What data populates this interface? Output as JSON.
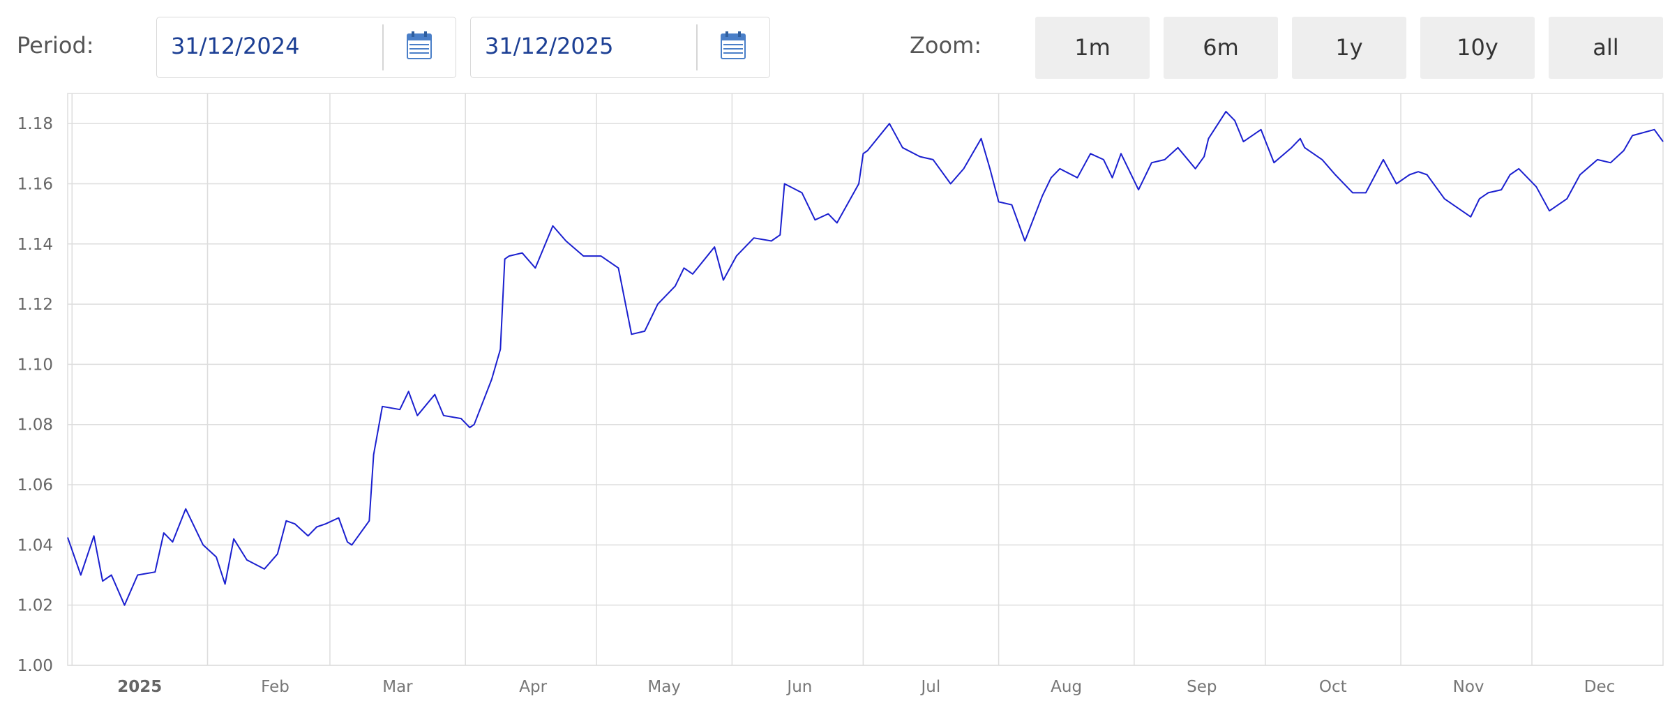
{
  "controls": {
    "period_label": "Period:",
    "date_from": "31/12/2024",
    "date_to": "31/12/2025",
    "zoom_label": "Zoom:",
    "zoom_options": [
      "1m",
      "6m",
      "1y",
      "10y",
      "all"
    ],
    "calendar_icon": "calendar-icon"
  },
  "colors": {
    "line": "#1a1fcf",
    "grid": "#dddddd",
    "date_text": "#1c3f94",
    "calendar": "#4a7fc8",
    "button_bg": "#eeeeee"
  },
  "chart_data": {
    "type": "line",
    "title": "",
    "xlabel": "",
    "ylabel": "",
    "x_range": [
      "2024-12-31",
      "2025-12-31"
    ],
    "ylim": [
      1.0,
      1.19
    ],
    "y_ticks": [
      "1.00",
      "1.02",
      "1.04",
      "1.06",
      "1.08",
      "1.10",
      "1.12",
      "1.14",
      "1.16",
      "1.18"
    ],
    "x_ticks": [
      {
        "date": "2025-01-01",
        "label": "2025",
        "bold": true
      },
      {
        "date": "2025-02-01",
        "label": "Feb"
      },
      {
        "date": "2025-03-01",
        "label": "Mar"
      },
      {
        "date": "2025-04-01",
        "label": "Apr"
      },
      {
        "date": "2025-05-01",
        "label": "May"
      },
      {
        "date": "2025-06-01",
        "label": "Jun"
      },
      {
        "date": "2025-07-01",
        "label": "Jul"
      },
      {
        "date": "2025-08-01",
        "label": "Aug"
      },
      {
        "date": "2025-09-01",
        "label": "Sep"
      },
      {
        "date": "2025-10-01",
        "label": "Oct"
      },
      {
        "date": "2025-11-01",
        "label": "Nov"
      },
      {
        "date": "2025-12-01",
        "label": "Dec"
      }
    ],
    "grid": true,
    "legend": "none",
    "x": [
      "2024-12-31",
      "2025-01-03",
      "2025-01-06",
      "2025-01-08",
      "2025-01-10",
      "2025-01-13",
      "2025-01-16",
      "2025-01-20",
      "2025-01-22",
      "2025-01-24",
      "2025-01-27",
      "2025-01-31",
      "2025-02-03",
      "2025-02-05",
      "2025-02-07",
      "2025-02-10",
      "2025-02-14",
      "2025-02-17",
      "2025-02-19",
      "2025-02-21",
      "2025-02-24",
      "2025-02-26",
      "2025-02-28",
      "2025-03-03",
      "2025-03-05",
      "2025-03-06",
      "2025-03-10",
      "2025-03-11",
      "2025-03-13",
      "2025-03-17",
      "2025-03-19",
      "2025-03-21",
      "2025-03-25",
      "2025-03-27",
      "2025-03-31",
      "2025-04-02",
      "2025-04-03",
      "2025-04-07",
      "2025-04-09",
      "2025-04-10",
      "2025-04-11",
      "2025-04-14",
      "2025-04-17",
      "2025-04-21",
      "2025-04-24",
      "2025-04-28",
      "2025-05-02",
      "2025-05-06",
      "2025-05-09",
      "2025-05-12",
      "2025-05-15",
      "2025-05-19",
      "2025-05-21",
      "2025-05-23",
      "2025-05-28",
      "2025-05-30",
      "2025-06-02",
      "2025-06-06",
      "2025-06-10",
      "2025-06-12",
      "2025-06-13",
      "2025-06-17",
      "2025-06-20",
      "2025-06-23",
      "2025-06-25",
      "2025-06-30",
      "2025-07-01",
      "2025-07-02",
      "2025-07-07",
      "2025-07-10",
      "2025-07-14",
      "2025-07-17",
      "2025-07-21",
      "2025-07-24",
      "2025-07-28",
      "2025-07-30",
      "2025-08-01",
      "2025-08-04",
      "2025-08-07",
      "2025-08-11",
      "2025-08-13",
      "2025-08-15",
      "2025-08-19",
      "2025-08-22",
      "2025-08-25",
      "2025-08-27",
      "2025-08-29",
      "2025-09-02",
      "2025-09-05",
      "2025-09-08",
      "2025-09-11",
      "2025-09-15",
      "2025-09-17",
      "2025-09-18",
      "2025-09-22",
      "2025-09-24",
      "2025-09-26",
      "2025-09-30",
      "2025-10-03",
      "2025-10-07",
      "2025-10-09",
      "2025-10-10",
      "2025-10-14",
      "2025-10-17",
      "2025-10-21",
      "2025-10-24",
      "2025-10-28",
      "2025-10-31",
      "2025-11-03",
      "2025-11-05",
      "2025-11-07",
      "2025-11-11",
      "2025-11-13",
      "2025-11-17",
      "2025-11-19",
      "2025-11-21",
      "2025-11-24",
      "2025-11-26",
      "2025-11-28",
      "2025-12-02",
      "2025-12-05",
      "2025-12-09",
      "2025-12-12",
      "2025-12-16",
      "2025-12-19",
      "2025-12-22",
      "2025-12-24",
      "2025-12-29",
      "2025-12-31"
    ],
    "series": [
      {
        "values": [
          1.0425,
          1.03,
          1.043,
          1.028,
          1.03,
          1.02,
          1.03,
          1.031,
          1.044,
          1.041,
          1.052,
          1.04,
          1.036,
          1.027,
          1.042,
          1.035,
          1.032,
          1.037,
          1.048,
          1.047,
          1.043,
          1.046,
          1.047,
          1.049,
          1.041,
          1.04,
          1.048,
          1.07,
          1.086,
          1.085,
          1.091,
          1.083,
          1.09,
          1.083,
          1.082,
          1.079,
          1.08,
          1.095,
          1.105,
          1.135,
          1.136,
          1.137,
          1.132,
          1.146,
          1.141,
          1.136,
          1.136,
          1.132,
          1.11,
          1.111,
          1.12,
          1.126,
          1.132,
          1.13,
          1.139,
          1.128,
          1.136,
          1.142,
          1.141,
          1.143,
          1.16,
          1.157,
          1.148,
          1.15,
          1.147,
          1.16,
          1.17,
          1.171,
          1.18,
          1.172,
          1.169,
          1.168,
          1.16,
          1.165,
          1.175,
          1.165,
          1.154,
          1.153,
          1.141,
          1.156,
          1.162,
          1.165,
          1.162,
          1.17,
          1.168,
          1.162,
          1.17,
          1.158,
          1.167,
          1.168,
          1.172,
          1.165,
          1.169,
          1.175,
          1.184,
          1.181,
          1.174,
          1.178,
          1.167,
          1.172,
          1.175,
          1.172,
          1.168,
          1.163,
          1.157,
          1.157,
          1.168,
          1.16,
          1.163,
          1.164,
          1.163,
          1.155,
          1.153,
          1.149,
          1.155,
          1.157,
          1.158,
          1.163,
          1.165,
          1.159,
          1.151,
          1.155,
          1.163,
          1.168,
          1.167,
          1.171,
          1.176,
          1.178,
          1.174
        ]
      }
    ]
  }
}
